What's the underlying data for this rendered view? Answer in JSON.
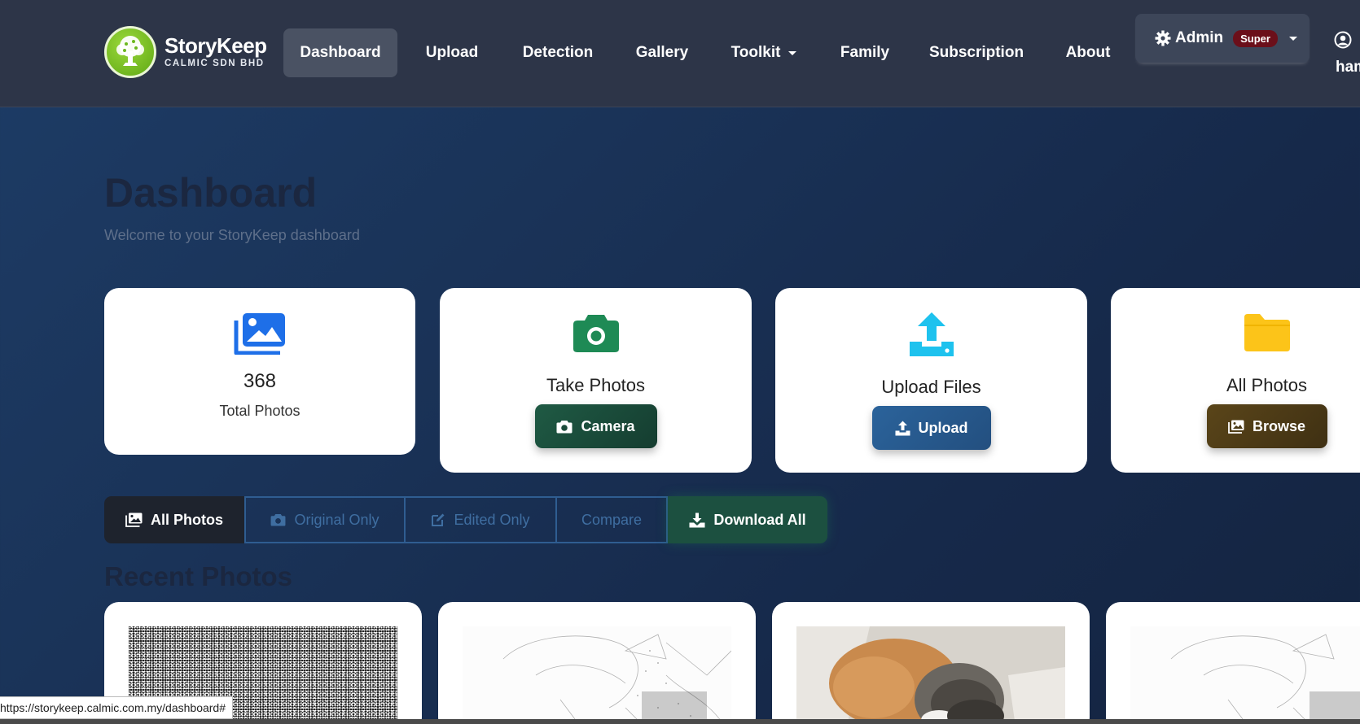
{
  "brand": {
    "name": "StoryKeep",
    "subtitle": "CALMIC SDN BHD"
  },
  "nav": {
    "items": [
      {
        "label": "Dashboard",
        "active": true
      },
      {
        "label": "Upload"
      },
      {
        "label": "Detection"
      },
      {
        "label": "Gallery"
      },
      {
        "label": "Toolkit",
        "dropdown": true
      },
      {
        "label": "Family"
      },
      {
        "label": "Subscription"
      },
      {
        "label": "About"
      }
    ],
    "admin": {
      "label": "Admin",
      "badge": "Super",
      "icon": "gear-icon"
    },
    "user": {
      "name_partial": "ham",
      "icon": "user-circle-icon"
    }
  },
  "header": {
    "title": "Dashboard",
    "subtitle": "Welcome to your StoryKeep dashboard"
  },
  "cards": [
    {
      "icon": "images-icon",
      "value": "368",
      "label": "Total Photos",
      "color": "#1e6fe8"
    },
    {
      "icon": "camera-icon",
      "title": "Take Photos",
      "button": "Camera",
      "color": "#1e8a55",
      "button_color": "#1b4d3a"
    },
    {
      "icon": "upload-icon",
      "title": "Upload Files",
      "button": "Upload",
      "color": "#1ec2ee",
      "button_color": "#275a90"
    },
    {
      "icon": "folder-icon",
      "title": "All Photos",
      "button": "Browse",
      "color": "#fcc419",
      "button_color": "#4b3a16"
    }
  ],
  "filters": [
    {
      "label": "All Photos",
      "icon": "images-icon",
      "active": true
    },
    {
      "label": "Original Only",
      "icon": "camera-icon"
    },
    {
      "label": "Edited Only",
      "icon": "edit-icon"
    },
    {
      "label": "Compare"
    },
    {
      "label": "Download All",
      "icon": "download-icon"
    }
  ],
  "recent": {
    "title": "Recent Photos"
  },
  "statusbar": {
    "url": "https://storykeep.calmic.com.my/dashboard#"
  }
}
